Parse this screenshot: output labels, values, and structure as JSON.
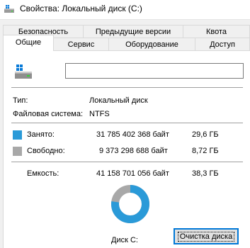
{
  "window": {
    "title": "Свойства: Локальный диск (C:)"
  },
  "tabs": {
    "back_row": [
      "Безопасность",
      "Предыдущие версии",
      "Квота"
    ],
    "front_row": [
      "Общие",
      "Сервис",
      "Оборудование",
      "Доступ"
    ],
    "active": "Общие"
  },
  "general": {
    "name_value": "",
    "type_label": "Тип:",
    "type_value": "Локальный диск",
    "fs_label": "Файловая система:",
    "fs_value": "NTFS",
    "used_label": "Занято:",
    "used_bytes": "31 785 402 368 байт",
    "used_human": "29,6 ГБ",
    "used_color": "#2a9ad8",
    "free_label": "Свободно:",
    "free_bytes": "9 373 298 688 байт",
    "free_human": "8,72 ГБ",
    "free_color": "#a8a8a8",
    "capacity_label": "Емкость:",
    "capacity_bytes": "41 158 701 056 байт",
    "capacity_human": "38,3 ГБ",
    "used_fraction": 0.772,
    "disk_label": "Диск C:",
    "cleanup_button": "Очистка диска"
  },
  "icons": {
    "title": "drive-icon",
    "drive": "windows-drive-icon"
  }
}
